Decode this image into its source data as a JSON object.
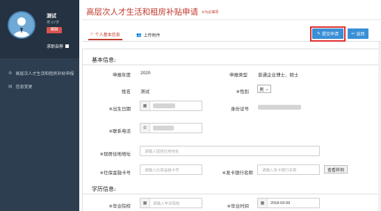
{
  "sidebar": {
    "user": {
      "name": "测试",
      "subtitle": "男 67岁",
      "badge": "编辑",
      "logout_label": "求职自荐"
    },
    "items": [
      {
        "icon": "gear-icon",
        "label": "高层次人才生活和租房补贴申报"
      },
      {
        "icon": "list-icon",
        "label": "信息变更"
      }
    ]
  },
  "header": {
    "title": "高层次人才生活和租房补贴申请",
    "note": "※为必填项"
  },
  "tabs": [
    {
      "icon": "home-icon",
      "label": "个人基本信息",
      "active": true
    },
    {
      "icon": "users-icon",
      "label": "上传附件",
      "active": false
    }
  ],
  "actions": {
    "submit_label": "提交申请",
    "back_label": "返回"
  },
  "basic": {
    "section_title": "基本信息:",
    "year_label": "申报年度",
    "year_value": "2020",
    "type_label": "申报类型",
    "type_value": "普通企业博士、硕士",
    "name_label": "姓名",
    "name_value": "测试",
    "gender_label": "※性别",
    "gender_value": "男",
    "birth_label": "※出生日期",
    "id_label": "身份证号",
    "phone_label": "※联系电话",
    "address_label": "※现居住地地址",
    "address_placeholder": "请输入现居住地地址",
    "social_label": "※社保金融卡号",
    "social_placeholder": "请输入社保金融卡号",
    "bank_label": "※发卡银行名称",
    "bank_placeholder": "请输入发卡银行名称",
    "sample_label": "查看样例"
  },
  "education": {
    "section_title": "学历信息:",
    "school_label": "※毕业院校",
    "school_placeholder": "请输入毕业院校",
    "grad_time_label": "※毕业时间",
    "grad_time_value": "2018-03-09"
  },
  "colors": {
    "sidebar": "#2d3e50",
    "accent_red": "#c0392b",
    "button_blue": "#3a8fd6"
  }
}
